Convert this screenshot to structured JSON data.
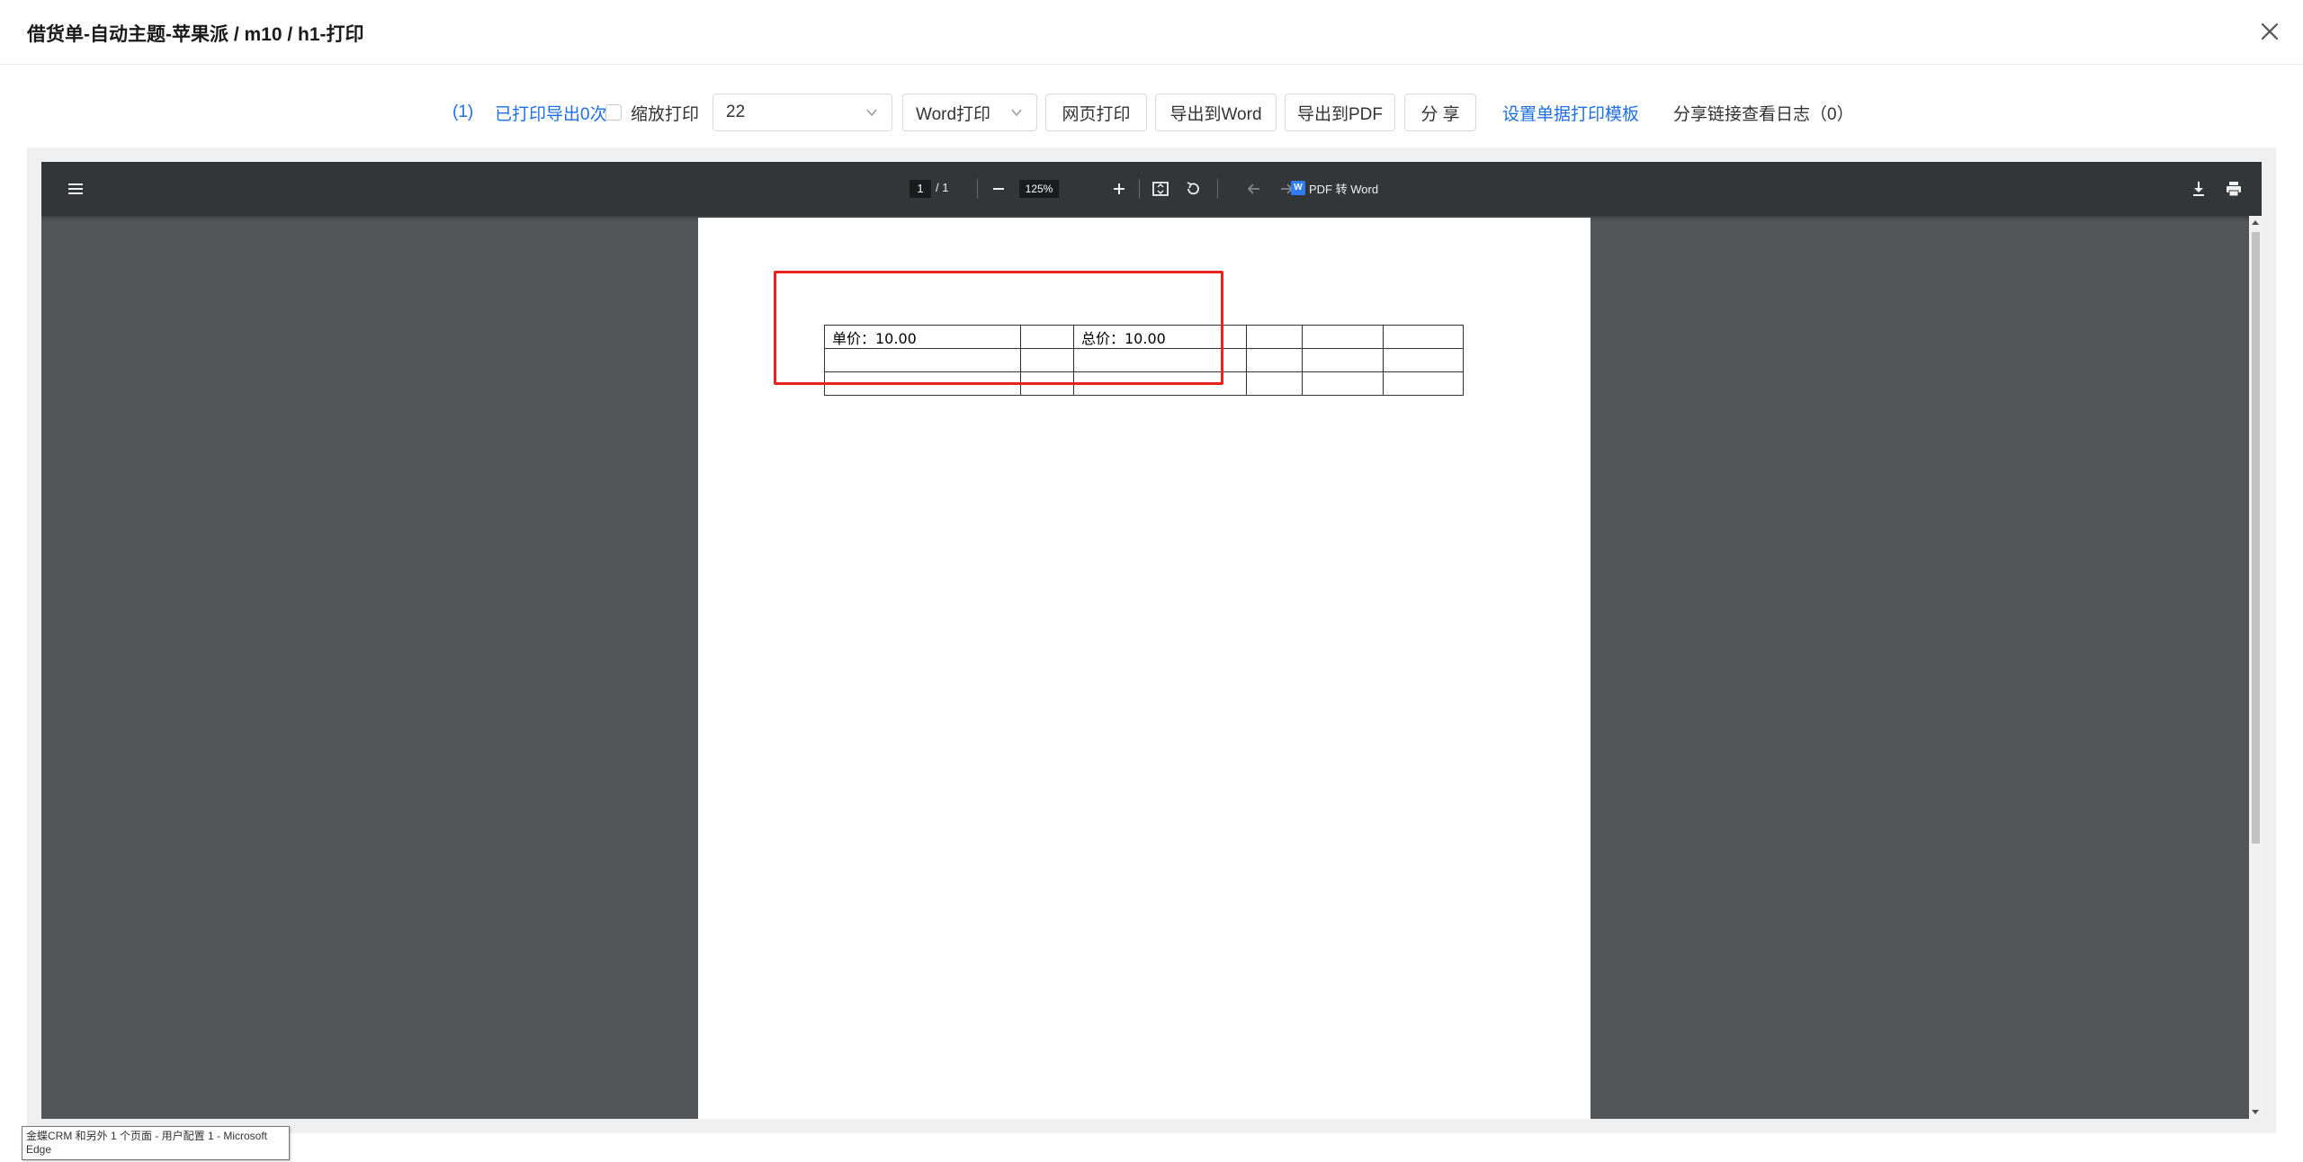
{
  "dialog": {
    "title": "借货单-自动主题-苹果派 / m10 / h1-打印"
  },
  "toolbar": {
    "count_link": "(1)",
    "printed_link": "已打印导出0次",
    "scale_print_label": "缩放打印",
    "template_select_value": "22",
    "print_mode_select_value": "Word打印",
    "web_print_label": "网页打印",
    "export_word_label": "导出到Word",
    "export_pdf_label": "导出到PDF",
    "share_label": "分 享",
    "template_settings_link": "设置单据打印模板",
    "share_log_label": "分享链接查看日志（0）"
  },
  "pdf_viewer": {
    "current_page": "1",
    "page_total": "/ 1",
    "zoom": "125%",
    "pdf_to_word_label": "PDF 转 Word",
    "pdf_to_word_badge": "W",
    "icons": [
      "menu-icon",
      "zoom-out-icon",
      "zoom-in-icon",
      "fit-page-icon",
      "rotate-icon",
      "prev-page-icon",
      "next-page-icon",
      "download-icon",
      "print-icon",
      "more-icon"
    ]
  },
  "document": {
    "table": [
      [
        "单价：10.00",
        "",
        "总价：10.00",
        "",
        "",
        ""
      ],
      [
        "",
        "",
        "",
        "",
        "",
        ""
      ],
      [
        "",
        "",
        "",
        "",
        "",
        ""
      ]
    ],
    "highlight_color": "#e8231f"
  },
  "tooltip": {
    "line1": "金蝶CRM 和另外 1 个页面 - 用户配置 1 - Microsoft",
    "line2": "Edge"
  },
  "colors": {
    "link": "#1e6fe8",
    "viewer_bg": "#525659",
    "viewer_toolbar": "#323639"
  }
}
